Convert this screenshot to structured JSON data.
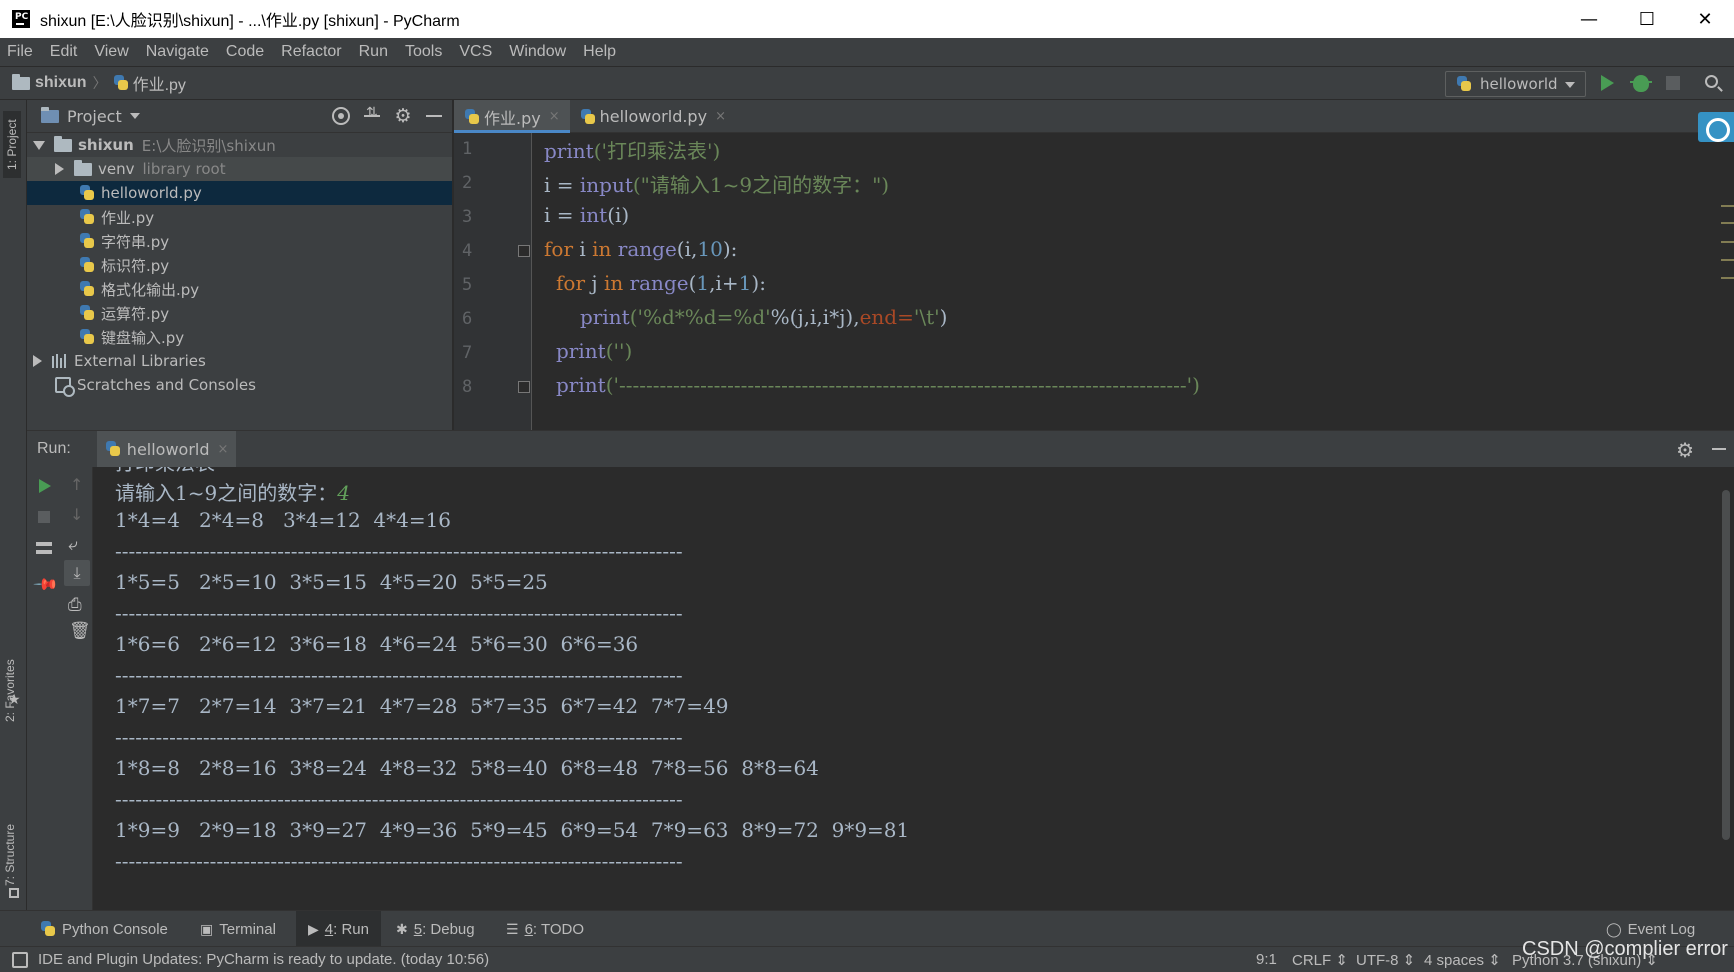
{
  "window": {
    "title": "shixun [E:\\人脸识别\\shixun] - ...\\作业.py [shixun] - PyCharm",
    "minimize": "—",
    "maximize": "☐",
    "close": "✕"
  },
  "menu": [
    "File",
    "Edit",
    "View",
    "Navigate",
    "Code",
    "Refactor",
    "Run",
    "Tools",
    "VCS",
    "Window",
    "Help"
  ],
  "navbar": {
    "project": "shixun",
    "file": "作业.py",
    "run_config": "helloworld"
  },
  "left_strip": {
    "project_tab": "1: Project",
    "favorites_tab": "2: Favorites",
    "structure_tab": "7: Structure"
  },
  "project_panel": {
    "title": "Project",
    "root_name": "shixun",
    "root_path": "E:\\人脸识别\\shixun",
    "venv_name": "venv",
    "venv_hint": "library root",
    "files": [
      "helloworld.py",
      "作业.py",
      "字符串.py",
      "标识符.py",
      "格式化输出.py",
      "运算符.py",
      "键盘输入.py"
    ],
    "external_libraries": "External Libraries",
    "scratches": "Scratches and Consoles"
  },
  "editor": {
    "tabs": [
      {
        "label": "作业.py",
        "close": "×"
      },
      {
        "label": "helloworld.py",
        "close": "×"
      }
    ],
    "line_numbers": [
      "1",
      "2",
      "3",
      "4",
      "5",
      "6",
      "7",
      "8"
    ],
    "code": {
      "l1_fn": "print",
      "l1_str": "('打印乘法表')",
      "l2_a": "i = ",
      "l2_fn": "input",
      "l2_str": "(\"请输入1~9之间的数字：\")",
      "l3_a": "i = ",
      "l3_fn": "int",
      "l3_b": "(i)",
      "l4_kw": "for",
      "l4_a": " i ",
      "l4_in": "in",
      "l4_fn": " range",
      "l4_b": "(i,",
      "l4_num": "10",
      "l4_c": "):",
      "l5_kw": "for",
      "l5_a": " j ",
      "l5_in": "in",
      "l5_fn": " range",
      "l5_b": "(",
      "l5_num": "1",
      "l5_c": ",i+",
      "l5_num2": "1",
      "l5_d": "):",
      "l6_fn": "print",
      "l6_str": "('%d*%d=%d'",
      "l6_a": "%(j,i,i*j),",
      "l6_kwarg": "end=",
      "l6_str2": "'\\t'",
      "l6_b": ")",
      "l7_fn": "print",
      "l7_str": "('')",
      "l8_fn": "print",
      "l8_str": "('------------------------------------------------------------------------------------')"
    }
  },
  "run_panel": {
    "label": "Run:",
    "tab": "helloworld",
    "tab_close": "×",
    "output": {
      "partial": "打印乘法表",
      "prompt": "请输入1~9之间的数字：",
      "input": "4",
      "lines": [
        "1*4=4   2*4=8   3*4=12  4*4=16",
        "------------------------------------------------------------------------------------",
        "1*5=5   2*5=10  3*5=15  4*5=20  5*5=25",
        "------------------------------------------------------------------------------------",
        "1*6=6   2*6=12  3*6=18  4*6=24  5*6=30  6*6=36",
        "------------------------------------------------------------------------------------",
        "1*7=7   2*7=14  3*7=21  4*7=28  5*7=35  6*7=42  7*7=49",
        "------------------------------------------------------------------------------------",
        "1*8=8   2*8=16  3*8=24  4*8=32  5*8=40  6*8=48  7*8=56  8*8=64",
        "------------------------------------------------------------------------------------",
        "1*9=9   2*9=18  3*9=27  4*9=36  5*9=45  6*9=54  7*9=63  8*9=72  9*9=81",
        "------------------------------------------------------------------------------------"
      ]
    }
  },
  "bottom_tabs": {
    "python_console": "Python Console",
    "terminal": "Terminal",
    "run_num": "4",
    "run_label": ": Run",
    "debug_num": "5",
    "debug_label": ": Debug",
    "todo_num": "6",
    "todo_label": ": TODO",
    "event_log": "Event Log"
  },
  "status_bar": {
    "message": "IDE and Plugin Updates: PyCharm is ready to update. (today 10:56)",
    "position": "9:1",
    "line_sep": "CRLF ⇕",
    "encoding": "UTF-8 ⇕",
    "indent": "4 spaces ⇕",
    "interpreter": "Python 3.7 (shixun) ⇕"
  },
  "watermark": "CSDN @complier error",
  "colors": {
    "background": "#2b2b2b",
    "panel": "#3c3f41",
    "selection": "#0d293e",
    "accent": "#4a88c7",
    "run_green": "#499c54"
  }
}
